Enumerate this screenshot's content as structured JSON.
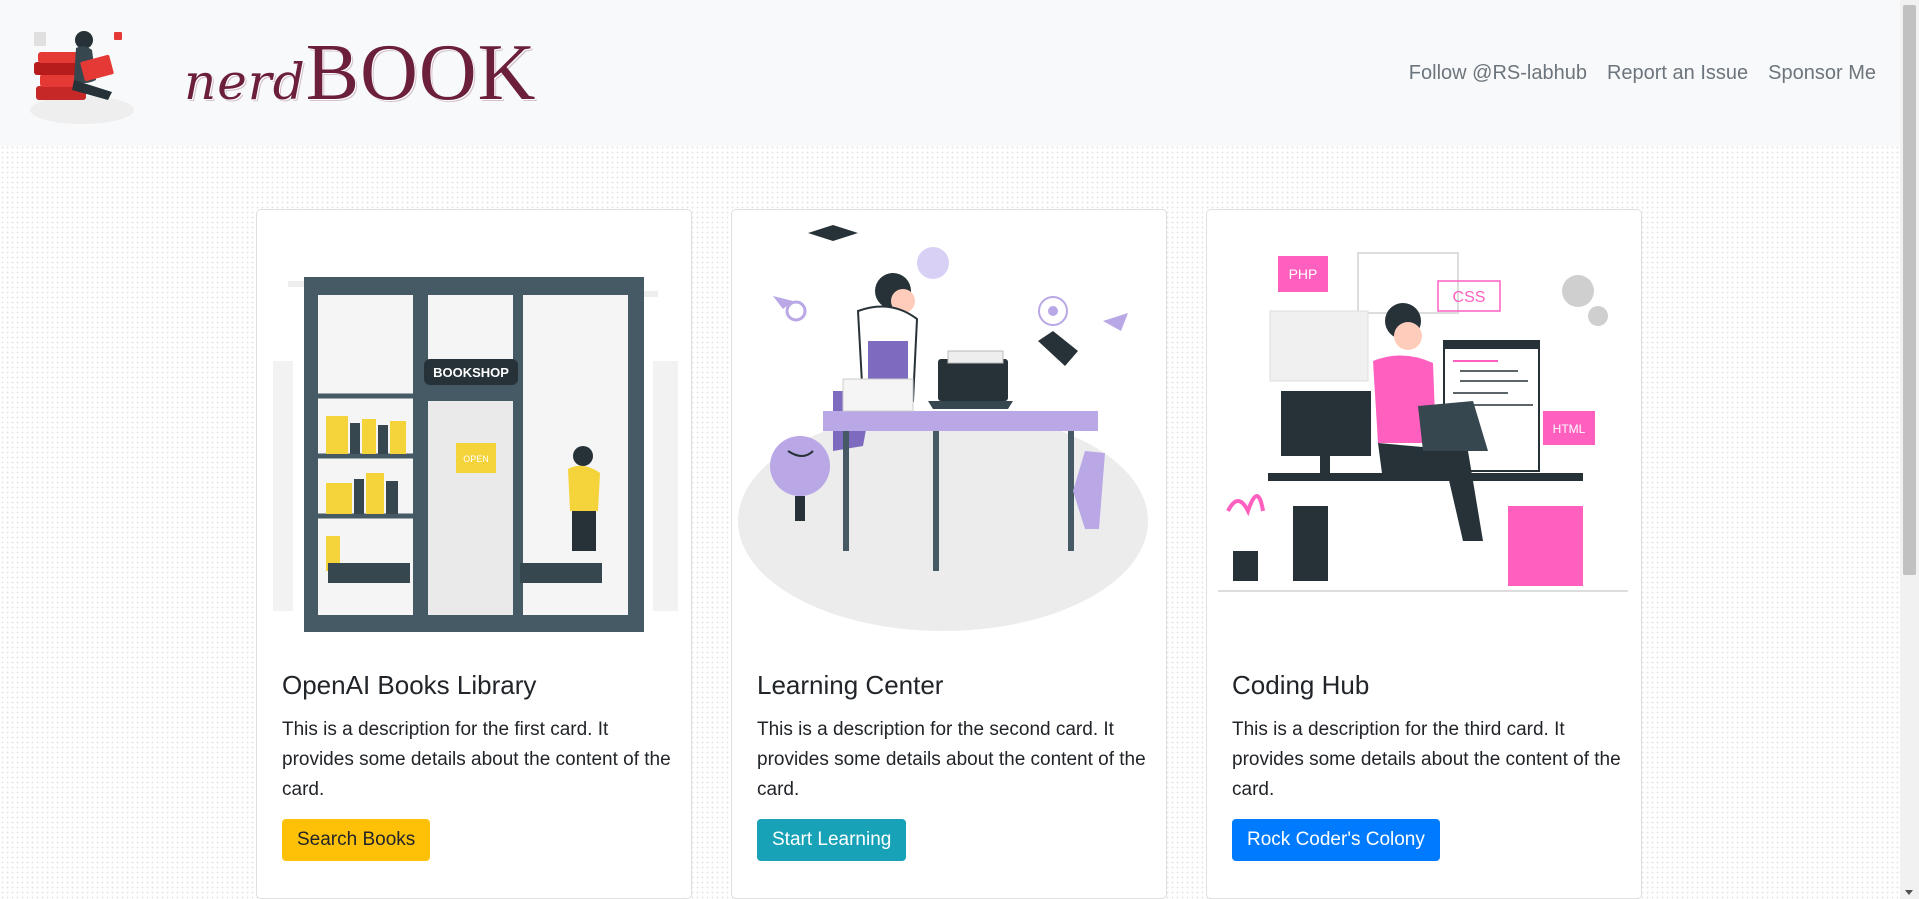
{
  "brand": {
    "name_small": "nerd",
    "name_big": "BOOK",
    "logo_icon": "girl-reading-books-logo"
  },
  "nav": {
    "links": [
      "Follow @RS-labhub",
      "Report an Issue",
      "Sponsor Me"
    ]
  },
  "cards": [
    {
      "illustration": "bookshop-storefront-illustration",
      "shop_sign": "BOOKSHOP",
      "door_sign": "OPEN",
      "title": "OpenAI Books Library",
      "text": "This is a description for the first card. It provides some details about the content of the card.",
      "button": "Search Books",
      "button_color": "#ffc107"
    },
    {
      "illustration": "student-studying-desk-illustration",
      "title": "Learning Center",
      "text": "This is a description for the second card. It provides some details about the content of the card.",
      "button": "Start Learning",
      "button_color": "#17a2b8"
    },
    {
      "illustration": "developer-coding-laptop-illustration",
      "tags": [
        "PHP",
        "CSS",
        "HTML"
      ],
      "title": "Coding Hub",
      "text": "This is a description for the third card. It provides some details about the content of the card.",
      "button": "Rock Coder's Colony",
      "button_color": "#007bff"
    }
  ],
  "colors": {
    "navbar_bg": "#f8f9fa",
    "brand": "#6b1f3a",
    "nav_link": "#6c757d",
    "accent_yellow": "#f5d33b",
    "accent_purple": "#b9a7e6",
    "accent_pink": "#ff5fbf"
  }
}
